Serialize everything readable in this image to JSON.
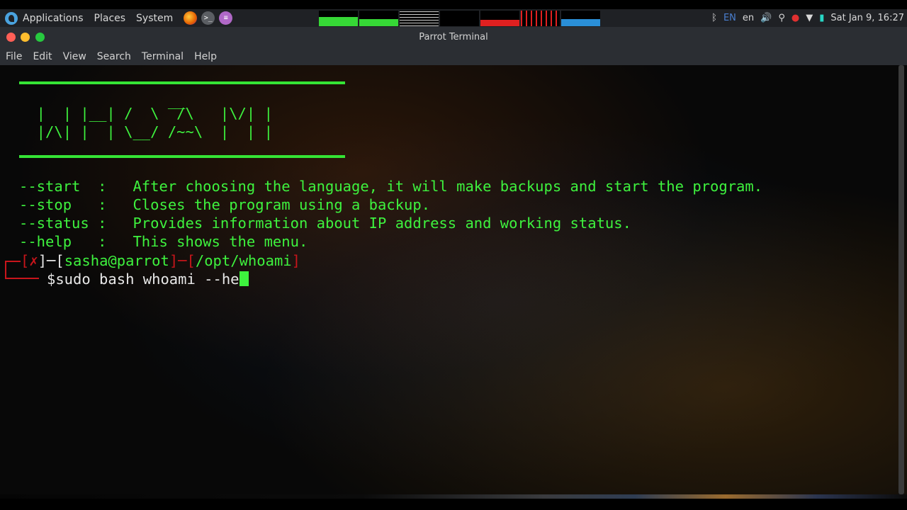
{
  "panel": {
    "menu": [
      "Applications",
      "Places",
      "System"
    ],
    "clock": "Sat Jan 9, 16:27",
    "keyboard_layout": "EN",
    "language": "en",
    "launcher_icons": [
      "firefox-icon",
      "terminal-icon",
      "text-editor-icon"
    ],
    "monitor_colors": [
      "#36d836",
      "#36d836",
      "#cfcfcf",
      "#2a8fd8",
      "#e02020",
      "#2a8fd8"
    ]
  },
  "window": {
    "title": "Parrot Terminal",
    "menus": [
      "File",
      "Edit",
      "View",
      "Search",
      "Terminal",
      "Help"
    ]
  },
  "terminal": {
    "ascii_lines": [
      "                 __",
      "  |  | |__| /  \\  /\\   |\\/| |",
      "  |/\\| |  | \\__/ /~~\\  |  | |"
    ],
    "help_lines": [
      "--start  :   After choosing the language, it will make backups and start the program.",
      "--stop   :   Closes the program using a backup.",
      "--status :   Provides information about IP address and working status.",
      "--help   :   This shows the menu."
    ],
    "prompt": {
      "status": "✗",
      "user_host": "sasha@parrot",
      "path": "/opt/whoami",
      "dollar": "$",
      "command": "sudo bash whoami --he"
    }
  },
  "colors": {
    "terminal_green": "#3ef23e",
    "prompt_red": "#c8151b"
  }
}
